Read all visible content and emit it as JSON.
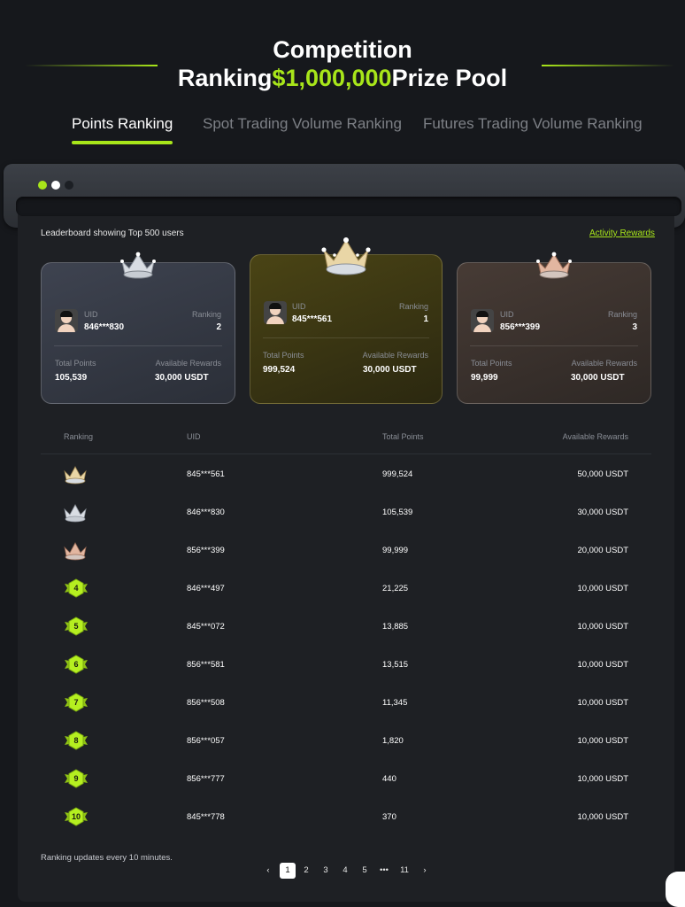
{
  "hero": {
    "line1": "Competition",
    "line2_prefix": "Ranking",
    "line2_amount": "$1,000,000",
    "line2_suffix": "Prize Pool"
  },
  "tabs": [
    {
      "label": "Points Ranking",
      "active": true
    },
    {
      "label": "Spot Trading Volume Ranking",
      "active": false
    },
    {
      "label": "Futures Trading Volume Ranking",
      "active": false
    }
  ],
  "window_dots": [
    "#a8e61a",
    "#ffffff",
    "#1c1f24"
  ],
  "leaderboard_info": "Leaderboard showing Top 500 users",
  "activity_rewards_link": "Activity Rewards",
  "podium": {
    "first": {
      "uid_label": "UID",
      "uid": "845***561",
      "ranking_label": "Ranking",
      "ranking": "1",
      "points_label": "Total Points",
      "points": "999,524",
      "rewards_label": "Available Rewards",
      "rewards": "30,000 USDT",
      "crown": "gold-crown-icon"
    },
    "second": {
      "uid_label": "UID",
      "uid": "846***830",
      "ranking_label": "Ranking",
      "ranking": "2",
      "points_label": "Total Points",
      "points": "105,539",
      "rewards_label": "Available Rewards",
      "rewards": "30,000 USDT",
      "crown": "silver-crown-icon"
    },
    "third": {
      "uid_label": "UID",
      "uid": "856***399",
      "ranking_label": "Ranking",
      "ranking": "3",
      "points_label": "Total Points",
      "points": "99,999",
      "rewards_label": "Available Rewards",
      "rewards": "30,000 USDT",
      "crown": "bronze-crown-icon"
    }
  },
  "table": {
    "headers": {
      "ranking": "Ranking",
      "uid": "UID",
      "points": "Total Points",
      "rewards": "Available Rewards"
    },
    "rows": [
      {
        "rank": "1",
        "icon": "gold-crown-icon",
        "uid": "845***561",
        "points": "999,524",
        "rewards": "50,000 USDT"
      },
      {
        "rank": "2",
        "icon": "silver-crown-icon",
        "uid": "846***830",
        "points": "105,539",
        "rewards": "30,000 USDT"
      },
      {
        "rank": "3",
        "icon": "bronze-crown-icon",
        "uid": "856***399",
        "points": "99,999",
        "rewards": "20,000 USDT"
      },
      {
        "rank": "4",
        "icon": "rank-badge-icon",
        "uid": "846***497",
        "points": "21,225",
        "rewards": "10,000 USDT"
      },
      {
        "rank": "5",
        "icon": "rank-badge-icon",
        "uid": "845***072",
        "points": "13,885",
        "rewards": "10,000 USDT"
      },
      {
        "rank": "6",
        "icon": "rank-badge-icon",
        "uid": "856***581",
        "points": "13,515",
        "rewards": "10,000 USDT"
      },
      {
        "rank": "7",
        "icon": "rank-badge-icon",
        "uid": "856***508",
        "points": "11,345",
        "rewards": "10,000 USDT"
      },
      {
        "rank": "8",
        "icon": "rank-badge-icon",
        "uid": "856***057",
        "points": "1,820",
        "rewards": "10,000 USDT"
      },
      {
        "rank": "9",
        "icon": "rank-badge-icon",
        "uid": "856***777",
        "points": "440",
        "rewards": "10,000 USDT"
      },
      {
        "rank": "10",
        "icon": "rank-badge-icon",
        "uid": "845***778",
        "points": "370",
        "rewards": "10,000 USDT"
      }
    ]
  },
  "footnote": "Ranking updates every 10 minutes.",
  "pagination": {
    "prev": "‹",
    "pages": [
      "1",
      "2",
      "3",
      "4",
      "5",
      "•••",
      "11"
    ],
    "current": "1",
    "next": "›"
  },
  "colors": {
    "accent": "#a8e61a",
    "background": "#16181c",
    "panel": "#1e2024"
  }
}
